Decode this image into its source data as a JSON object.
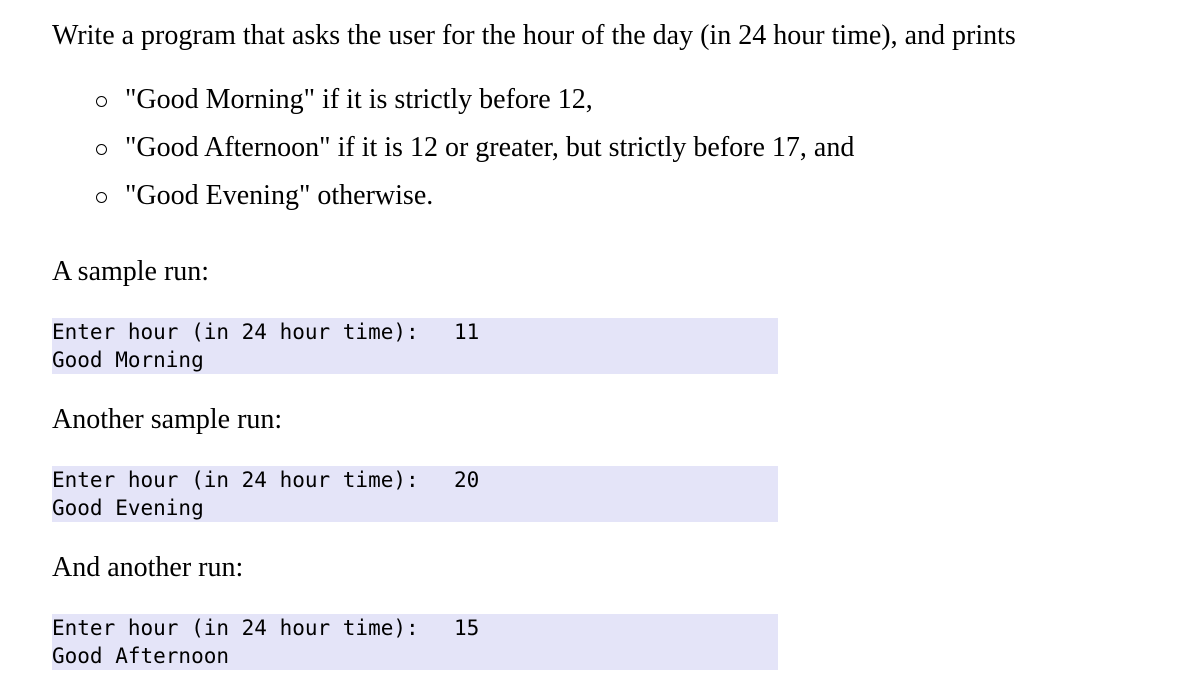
{
  "intro": "Write a program that asks the user for the hour of the day (in 24 hour time), and prints",
  "bullets": [
    "\"Good Morning\" if it is strictly before 12,",
    "\"Good Afternoon\" if it is 12 or greater, but strictly before 17, and",
    "\"Good Evening\" otherwise."
  ],
  "runs": [
    {
      "heading": "A sample run:",
      "prompt": "Enter hour (in 24 hour time):",
      "answer": "11",
      "output": "Good Morning"
    },
    {
      "heading": "Another sample run:",
      "prompt": "Enter hour (in 24 hour time):",
      "answer": "20",
      "output": "Good Evening"
    },
    {
      "heading": "And another run:",
      "prompt": "Enter hour (in 24 hour time):",
      "answer": "15",
      "output": "Good Afternoon"
    }
  ]
}
